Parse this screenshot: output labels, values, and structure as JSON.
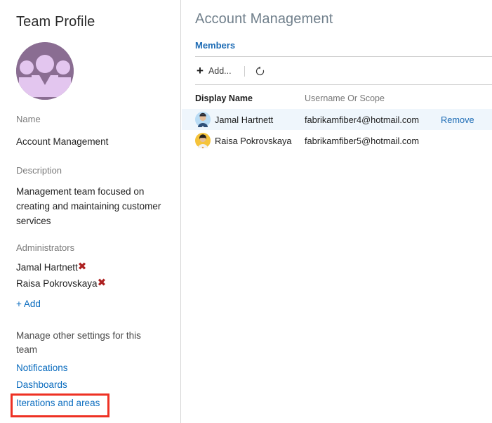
{
  "sidebar": {
    "title": "Team Profile",
    "avatar_icon": "team-group-icon",
    "avatar_color": "#8a6d92",
    "avatar_fg_color": "#e3c6ef",
    "fields": {
      "name_label": "Name",
      "name_value": "Account Management",
      "description_label": "Description",
      "description_value": "Management team focused on creating and maintaining customer services",
      "administrators_label": "Administrators"
    },
    "administrators": [
      {
        "name": "Jamal Hartnett",
        "remove_icon": "close-x-icon"
      },
      {
        "name": "Raisa Pokrovskaya",
        "remove_icon": "close-x-icon"
      }
    ],
    "add_admin_label": "+ Add",
    "manage_note": "Manage other settings for this team",
    "nav_links": [
      {
        "label": "Notifications",
        "highlighted": false
      },
      {
        "label": "Dashboards",
        "highlighted": false
      },
      {
        "label": "Iterations and areas",
        "highlighted": true
      }
    ],
    "highlight_color": "#ee3124",
    "link_color": "#0a6cbf",
    "remove_x_color": "#ad2020"
  },
  "main": {
    "title": "Account Management",
    "pivot_label": "Members",
    "pivot_color": "#1e6cb5",
    "toolbar": {
      "add_icon": "plus-icon",
      "add_label": "Add...",
      "refresh_icon": "refresh-icon"
    },
    "table": {
      "columns": [
        "Display Name",
        "Username Or Scope",
        ""
      ],
      "rows": [
        {
          "avatar_icon": "user-avatar-icon",
          "avatar_bg": "#b9dcf5",
          "display_name": "Jamal Hartnett",
          "username": "fabrikamfiber4@hotmail.com",
          "action_label": "Remove",
          "selected": true
        },
        {
          "avatar_icon": "user-avatar-icon",
          "avatar_bg": "#f5c33b",
          "display_name": "Raisa Pokrovskaya",
          "username": "fabrikamfiber5@hotmail.com",
          "action_label": "",
          "selected": false
        }
      ]
    }
  }
}
